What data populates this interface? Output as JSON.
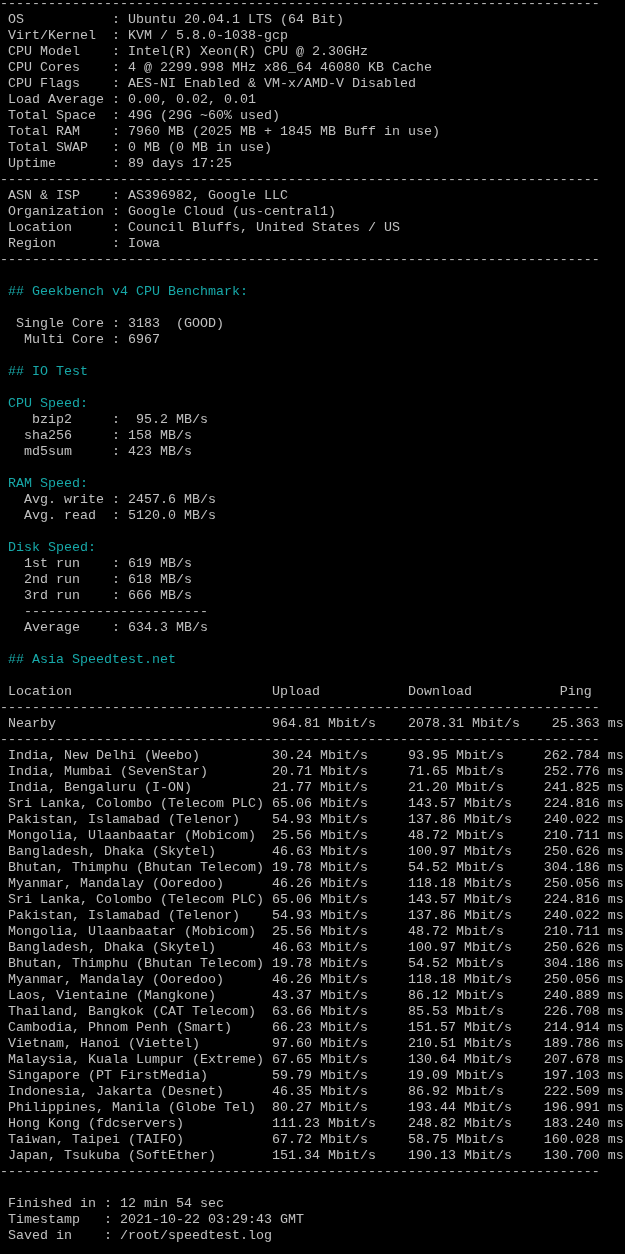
{
  "blocks": [
    {
      "kind": "rule",
      "text": "---------------------------------------------------------------------------"
    },
    {
      "kind": "text",
      "text": "OS           : Ubuntu 20.04.1 LTS (64 Bit)"
    },
    {
      "kind": "text",
      "text": "Virt/Kernel  : KVM / 5.8.0-1038-gcp"
    },
    {
      "kind": "text",
      "text": "CPU Model    : Intel(R) Xeon(R) CPU @ 2.30GHz"
    },
    {
      "kind": "text",
      "text": "CPU Cores    : 4 @ 2299.998 MHz x86_64 46080 KB Cache"
    },
    {
      "kind": "text",
      "text": "CPU Flags    : AES-NI Enabled & VM-x/AMD-V Disabled"
    },
    {
      "kind": "text",
      "text": "Load Average : 0.00, 0.02, 0.01"
    },
    {
      "kind": "text",
      "text": "Total Space  : 49G (29G ~60% used)"
    },
    {
      "kind": "text",
      "text": "Total RAM    : 7960 MB (2025 MB + 1845 MB Buff in use)"
    },
    {
      "kind": "text",
      "text": "Total SWAP   : 0 MB (0 MB in use)"
    },
    {
      "kind": "text",
      "text": "Uptime       : 89 days 17:25"
    },
    {
      "kind": "rule",
      "text": "---------------------------------------------------------------------------"
    },
    {
      "kind": "text",
      "text": "ASN & ISP    : AS396982, Google LLC"
    },
    {
      "kind": "text",
      "text": "Organization : Google Cloud (us-central1)"
    },
    {
      "kind": "text",
      "text": "Location     : Council Bluffs, United States / US"
    },
    {
      "kind": "text",
      "text": "Region       : Iowa"
    },
    {
      "kind": "rule",
      "text": "---------------------------------------------------------------------------"
    },
    {
      "kind": "blank"
    },
    {
      "kind": "heading",
      "text": "## Geekbench v4 CPU Benchmark:"
    },
    {
      "kind": "blank"
    },
    {
      "kind": "text",
      "text": " Single Core : 3183  (GOOD)"
    },
    {
      "kind": "text",
      "text": "  Multi Core : 6967"
    },
    {
      "kind": "blank"
    },
    {
      "kind": "heading",
      "text": "## IO Test"
    },
    {
      "kind": "blank"
    },
    {
      "kind": "heading",
      "text": "CPU Speed:"
    },
    {
      "kind": "text",
      "text": "   bzip2     :  95.2 MB/s"
    },
    {
      "kind": "text",
      "text": "  sha256     : 158 MB/s"
    },
    {
      "kind": "text",
      "text": "  md5sum     : 423 MB/s"
    },
    {
      "kind": "blank"
    },
    {
      "kind": "heading",
      "text": "RAM Speed:"
    },
    {
      "kind": "text",
      "text": "  Avg. write : 2457.6 MB/s"
    },
    {
      "kind": "text",
      "text": "  Avg. read  : 5120.0 MB/s"
    },
    {
      "kind": "blank"
    },
    {
      "kind": "heading",
      "text": "Disk Speed:"
    },
    {
      "kind": "text",
      "text": "  1st run    : 619 MB/s"
    },
    {
      "kind": "text",
      "text": "  2nd run    : 618 MB/s"
    },
    {
      "kind": "text",
      "text": "  3rd run    : 666 MB/s"
    },
    {
      "kind": "text",
      "text": "  -----------------------"
    },
    {
      "kind": "text",
      "text": "  Average    : 634.3 MB/s"
    },
    {
      "kind": "blank"
    },
    {
      "kind": "heading",
      "text": "## Asia Speedtest.net"
    },
    {
      "kind": "blank"
    },
    {
      "kind": "table_header",
      "cells": [
        "Location",
        "Upload",
        "Download",
        "Ping"
      ]
    },
    {
      "kind": "rule",
      "text": "---------------------------------------------------------------------------"
    },
    {
      "kind": "table_row",
      "cells": [
        "Nearby",
        "964.81 Mbit/s",
        "2078.31 Mbit/s",
        "25.363 ms"
      ]
    },
    {
      "kind": "rule",
      "text": "---------------------------------------------------------------------------"
    },
    {
      "kind": "table_row",
      "cells": [
        "India, New Delhi (Weebo)",
        "30.24 Mbit/s",
        "93.95 Mbit/s",
        "262.784 ms"
      ]
    },
    {
      "kind": "table_row",
      "cells": [
        "India, Mumbai (SevenStar)",
        "20.71 Mbit/s",
        "71.65 Mbit/s",
        "252.776 ms"
      ]
    },
    {
      "kind": "table_row",
      "cells": [
        "India, Bengaluru (I-ON)",
        "21.77 Mbit/s",
        "21.20 Mbit/s",
        "241.825 ms"
      ]
    },
    {
      "kind": "table_row",
      "cells": [
        "Sri Lanka, Colombo (Telecom PLC)",
        "65.06 Mbit/s",
        "143.57 Mbit/s",
        "224.816 ms"
      ]
    },
    {
      "kind": "table_row",
      "cells": [
        "Pakistan, Islamabad (Telenor)",
        "54.93 Mbit/s",
        "137.86 Mbit/s",
        "240.022 ms"
      ]
    },
    {
      "kind": "table_row",
      "cells": [
        "Mongolia, Ulaanbaatar (Mobicom)",
        "25.56 Mbit/s",
        "48.72 Mbit/s",
        "210.711 ms"
      ]
    },
    {
      "kind": "table_row",
      "cells": [
        "Bangladesh, Dhaka (Skytel)",
        "46.63 Mbit/s",
        "100.97 Mbit/s",
        "250.626 ms"
      ]
    },
    {
      "kind": "table_row",
      "cells": [
        "Bhutan, Thimphu (Bhutan Telecom)",
        "19.78 Mbit/s",
        "54.52 Mbit/s",
        "304.186 ms"
      ]
    },
    {
      "kind": "table_row",
      "cells": [
        "Myanmar, Mandalay (Ooredoo)",
        "46.26 Mbit/s",
        "118.18 Mbit/s",
        "250.056 ms"
      ]
    },
    {
      "kind": "table_row",
      "cells": [
        "Sri Lanka, Colombo (Telecom PLC)",
        "65.06 Mbit/s",
        "143.57 Mbit/s",
        "224.816 ms"
      ]
    },
    {
      "kind": "table_row",
      "cells": [
        "Pakistan, Islamabad (Telenor)",
        "54.93 Mbit/s",
        "137.86 Mbit/s",
        "240.022 ms"
      ]
    },
    {
      "kind": "table_row",
      "cells": [
        "Mongolia, Ulaanbaatar (Mobicom)",
        "25.56 Mbit/s",
        "48.72 Mbit/s",
        "210.711 ms"
      ]
    },
    {
      "kind": "table_row",
      "cells": [
        "Bangladesh, Dhaka (Skytel)",
        "46.63 Mbit/s",
        "100.97 Mbit/s",
        "250.626 ms"
      ]
    },
    {
      "kind": "table_row",
      "cells": [
        "Bhutan, Thimphu (Bhutan Telecom)",
        "19.78 Mbit/s",
        "54.52 Mbit/s",
        "304.186 ms"
      ]
    },
    {
      "kind": "table_row",
      "cells": [
        "Myanmar, Mandalay (Ooredoo)",
        "46.26 Mbit/s",
        "118.18 Mbit/s",
        "250.056 ms"
      ]
    },
    {
      "kind": "table_row",
      "cells": [
        "Laos, Vientaine (Mangkone)",
        "43.37 Mbit/s",
        "86.12 Mbit/s",
        "240.889 ms"
      ]
    },
    {
      "kind": "table_row",
      "cells": [
        "Thailand, Bangkok (CAT Telecom)",
        "63.66 Mbit/s",
        "85.53 Mbit/s",
        "226.708 ms"
      ]
    },
    {
      "kind": "table_row",
      "cells": [
        "Cambodia, Phnom Penh (Smart)",
        "66.23 Mbit/s",
        "151.57 Mbit/s",
        "214.914 ms"
      ]
    },
    {
      "kind": "table_row",
      "cells": [
        "Vietnam, Hanoi (Viettel)",
        "97.60 Mbit/s",
        "210.51 Mbit/s",
        "189.786 ms"
      ]
    },
    {
      "kind": "table_row",
      "cells": [
        "Malaysia, Kuala Lumpur (Extreme)",
        "67.65 Mbit/s",
        "130.64 Mbit/s",
        "207.678 ms"
      ]
    },
    {
      "kind": "table_row",
      "cells": [
        "Singapore (PT FirstMedia)",
        "59.79 Mbit/s",
        "19.09 Mbit/s",
        "197.103 ms"
      ]
    },
    {
      "kind": "table_row",
      "cells": [
        "Indonesia, Jakarta (Desnet)",
        "46.35 Mbit/s",
        "86.92 Mbit/s",
        "222.509 ms"
      ]
    },
    {
      "kind": "table_row",
      "cells": [
        "Philippines, Manila (Globe Tel)",
        "80.27 Mbit/s",
        "193.44 Mbit/s",
        "196.991 ms"
      ]
    },
    {
      "kind": "table_row",
      "cells": [
        "Hong Kong (fdcservers)",
        "111.23 Mbit/s",
        "248.82 Mbit/s",
        "183.240 ms"
      ]
    },
    {
      "kind": "table_row",
      "cells": [
        "Taiwan, Taipei (TAIFO)",
        "67.72 Mbit/s",
        "58.75 Mbit/s",
        "160.028 ms"
      ]
    },
    {
      "kind": "table_row",
      "cells": [
        "Japan, Tsukuba (SoftEther)",
        "151.34 Mbit/s",
        "190.13 Mbit/s",
        "130.700 ms"
      ]
    },
    {
      "kind": "rule",
      "text": "---------------------------------------------------------------------------"
    },
    {
      "kind": "blank"
    },
    {
      "kind": "text",
      "text": "Finished in : 12 min 54 sec"
    },
    {
      "kind": "text",
      "text": "Timestamp   : 2021-10-22 03:29:43 GMT"
    },
    {
      "kind": "text",
      "text": "Saved in    : /root/speedtest.log"
    }
  ]
}
